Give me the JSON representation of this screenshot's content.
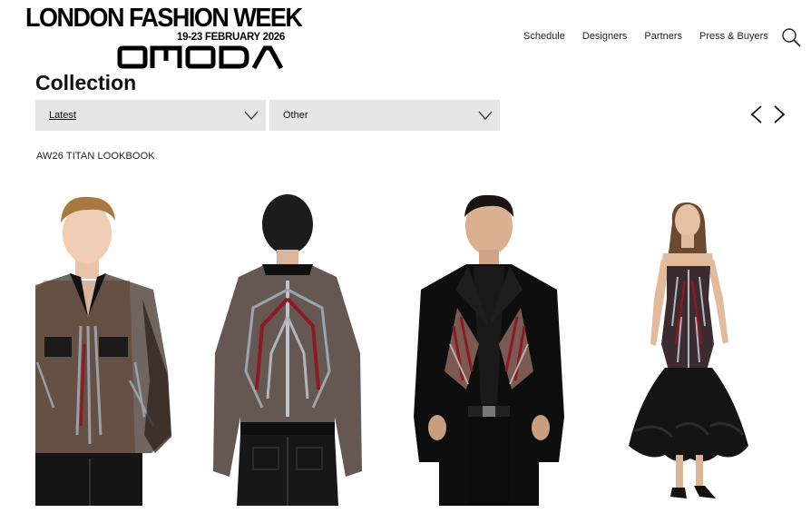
{
  "brand": {
    "title": "LONDON FASHION WEEK",
    "dates": "19-23 FEBRUARY 2026",
    "sponsor": "OMODA"
  },
  "nav": {
    "items": [
      {
        "label": "Schedule"
      },
      {
        "label": "Designers"
      },
      {
        "label": "Partners"
      },
      {
        "label": "Press & Buyers"
      }
    ]
  },
  "page": {
    "title": "Collection",
    "subtitle": "AW26 TITAN LOOKBOOK"
  },
  "filters": {
    "season": {
      "value": "Latest"
    },
    "category": {
      "value": "Other"
    }
  },
  "icons": {
    "search": "search-icon",
    "prev": "chevron-left-icon",
    "next": "chevron-right-icon",
    "dropdown": "chevron-down-icon"
  },
  "colors": {
    "dropdown_bg": "#e6e6e6",
    "text": "#111111",
    "accent_red": "#8b1a22"
  }
}
